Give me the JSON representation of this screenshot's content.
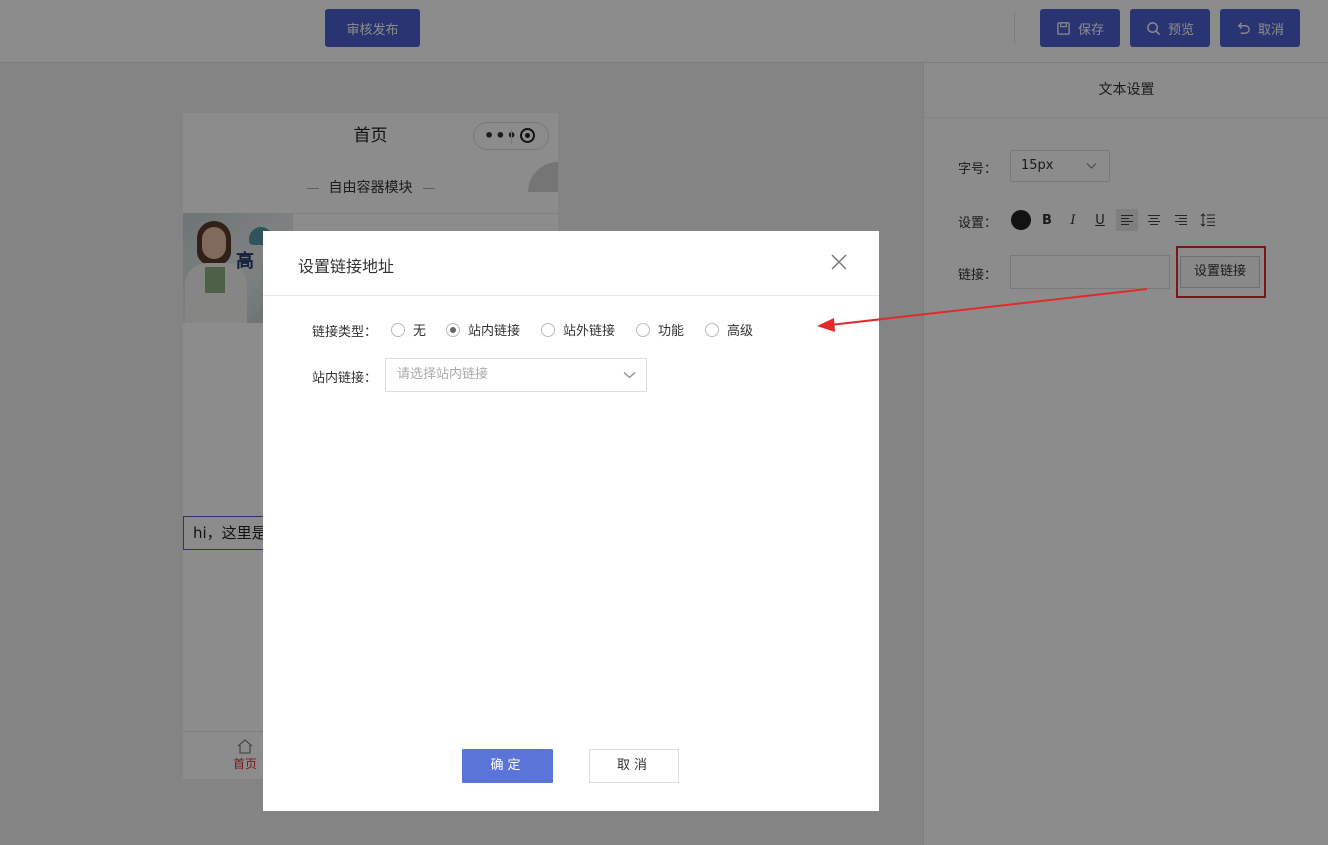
{
  "topbar": {
    "publish_label": "审核发布",
    "save_label": "保存",
    "preview_label": "预览",
    "cancel_label": "取消",
    "accent_color": "#4b5fd0"
  },
  "phone": {
    "title": "首页",
    "menu_glyph": "•••",
    "container_label": "自由容器模块",
    "banner_char": "高",
    "text_content": "hi，这里是",
    "tab_home_label": "首页",
    "tab_active_color": "#d4342c"
  },
  "panel": {
    "title": "文本设置",
    "font_size_label": "字号：",
    "font_size_value": "15px",
    "style_label": "设置：",
    "bold": "B",
    "italic": "I",
    "underline": "U",
    "link_label": "链接：",
    "link_button": "设置链接"
  },
  "dialog": {
    "title": "设置链接地址",
    "link_type_label": "链接类型：",
    "options": [
      "无",
      "站内链接",
      "站外链接",
      "功能",
      "高级"
    ],
    "selected_option": "站内链接",
    "internal_link_label": "站内链接：",
    "internal_link_placeholder": "请选择站内链接",
    "ok_label": "确定",
    "cancel_label": "取消",
    "ok_color": "#5b74d8"
  },
  "annotation": {
    "highlight_color": "#e02b2b"
  }
}
